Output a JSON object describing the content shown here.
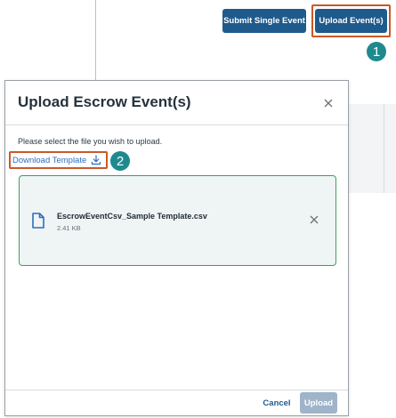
{
  "background_page": {
    "submit_single_label": "Submit Single Event",
    "upload_events_label": "Upload Event(s)"
  },
  "steps": {
    "step1": "1",
    "step2": "2"
  },
  "modal": {
    "title": "Upload Escrow Event(s)",
    "close_icon": "close-icon",
    "instructions": "Please select the file you wish to upload.",
    "download_template_label": "Download Template",
    "download_icon": "download-icon",
    "file": {
      "name": "EscrowEventCsv_Sample Template.csv",
      "size": "2.41 KB",
      "icon": "file-icon",
      "remove_icon": "close-icon"
    },
    "footer": {
      "cancel_label": "Cancel",
      "upload_label": "Upload"
    }
  },
  "colors": {
    "primary": "#1f5a8c",
    "highlight": "#c8592a",
    "step_badge": "#1e8a8f",
    "file_border": "#3ea05a",
    "file_bg": "#eef5f4",
    "link": "#2f6cc2",
    "upload_disabled": "#9fb4c9"
  }
}
